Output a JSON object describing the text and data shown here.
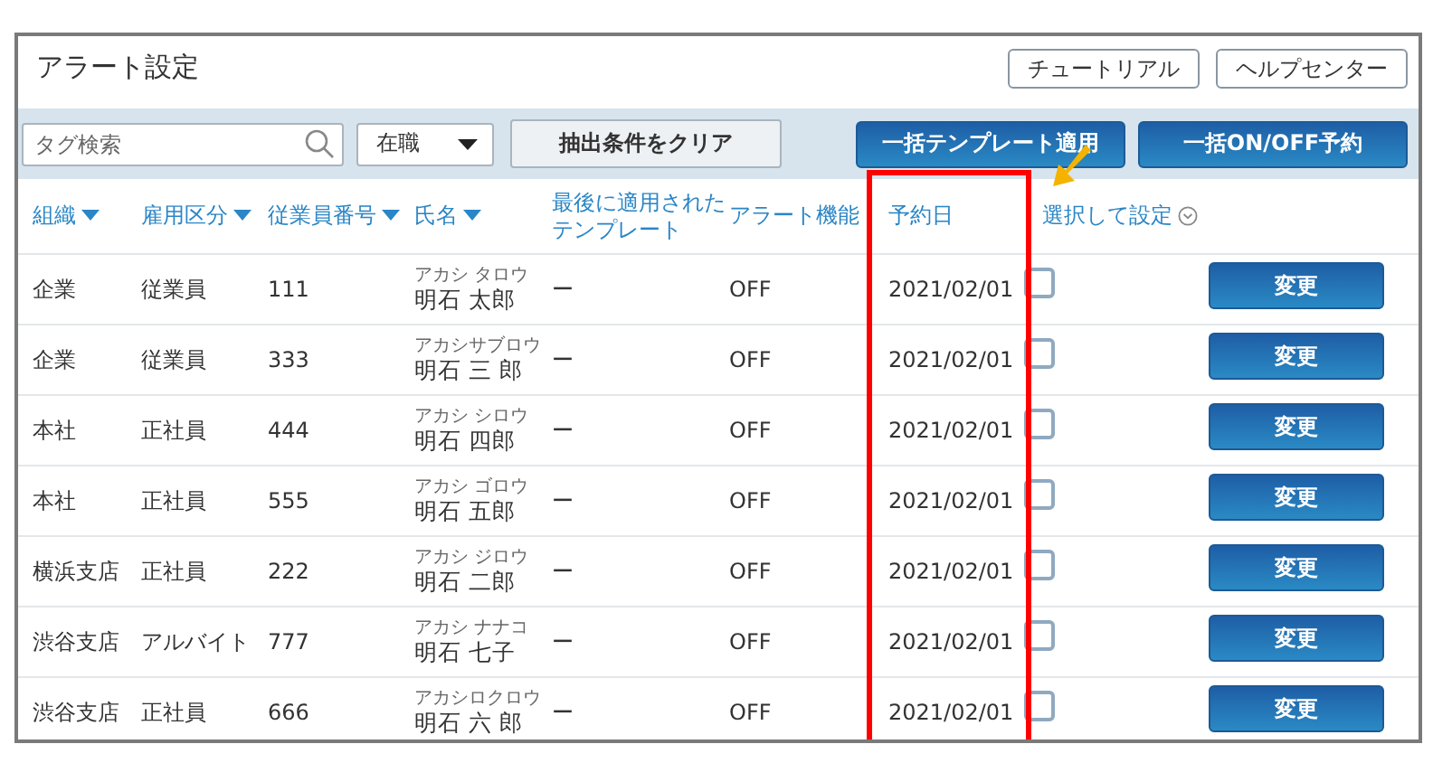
{
  "title": "アラート設定",
  "header_buttons": [
    "チュートリアル",
    "ヘルプセンター"
  ],
  "toolbar": {
    "search": {
      "placeholder": "タグ検索"
    },
    "status_select": {
      "value": "在職"
    },
    "clear_button": "抽出条件をクリア",
    "action_buttons": [
      "一括テンプレート適用",
      "一括ON/OFF予約"
    ]
  },
  "table": {
    "columns": [
      {
        "label": "組織",
        "kind": "sort"
      },
      {
        "label": "雇用区分",
        "kind": "sort"
      },
      {
        "label": "従業員番号",
        "kind": "sort"
      },
      {
        "label": "氏名",
        "kind": "sort"
      },
      {
        "label": "最後に適用されたテンプレート",
        "kind": "plain"
      },
      {
        "label": "アラート機能",
        "kind": "plain"
      },
      {
        "label": "予約日",
        "kind": "plain"
      },
      {
        "label": "選択して設定",
        "kind": "menu"
      }
    ],
    "rows": [
      {
        "org": "企業",
        "type": "従業員",
        "number": "111",
        "kana": "アカシ タロウ",
        "name": "明石 太郎",
        "template": "ー",
        "alert": "OFF",
        "date": "2021/02/01",
        "checked": false,
        "action": "変更"
      },
      {
        "org": "企業",
        "type": "従業員",
        "number": "333",
        "kana": "アカシサブロウ",
        "name": "明石 三 郎",
        "template": "ー",
        "alert": "OFF",
        "date": "2021/02/01",
        "checked": false,
        "action": "変更"
      },
      {
        "org": "本社",
        "type": "正社員",
        "number": "444",
        "kana": "アカシ シロウ",
        "name": "明石 四郎",
        "template": "ー",
        "alert": "OFF",
        "date": "2021/02/01",
        "checked": false,
        "action": "変更"
      },
      {
        "org": "本社",
        "type": "正社員",
        "number": "555",
        "kana": "アカシ ゴロウ",
        "name": "明石 五郎",
        "template": "ー",
        "alert": "OFF",
        "date": "2021/02/01",
        "checked": false,
        "action": "変更"
      },
      {
        "org": "横浜支店",
        "type": "正社員",
        "number": "222",
        "kana": "アカシ ジロウ",
        "name": "明石 二郎",
        "template": "ー",
        "alert": "OFF",
        "date": "2021/02/01",
        "checked": false,
        "action": "変更"
      },
      {
        "org": "渋谷支店",
        "type": "アルバイト",
        "number": "777",
        "kana": "アカシ ナナコ",
        "name": "明石 七子",
        "template": "ー",
        "alert": "OFF",
        "date": "2021/02/01",
        "checked": false,
        "action": "変更"
      },
      {
        "org": "渋谷支店",
        "type": "正社員",
        "number": "666",
        "kana": "アカシロクロウ",
        "name": "明石 六 郎",
        "template": "ー",
        "alert": "OFF",
        "date": "2021/02/01",
        "checked": false,
        "action": "変更"
      }
    ]
  }
}
